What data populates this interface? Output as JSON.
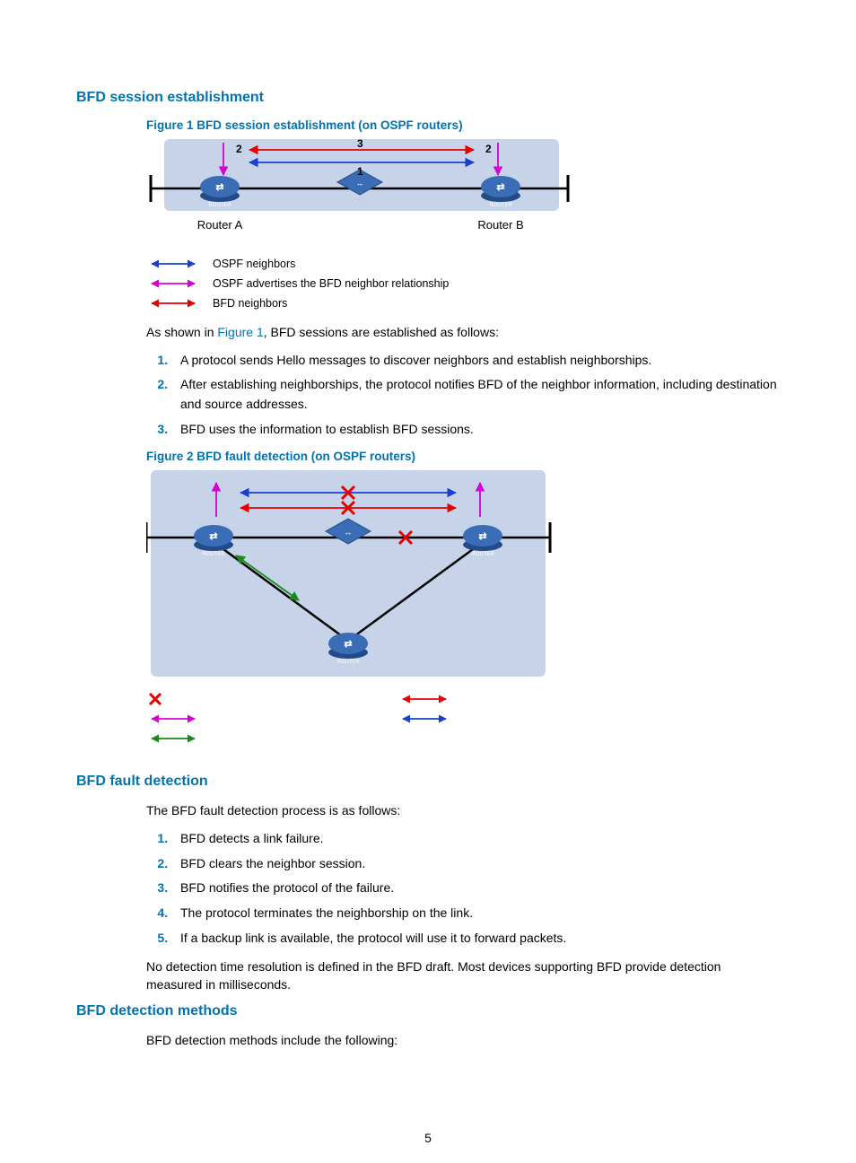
{
  "h_session": "BFD session establishment",
  "fig1_cap": "Figure 1 BFD session establishment (on OSPF routers)",
  "fig1": {
    "n1": "1",
    "n2l": "2",
    "n2r": "2",
    "n3": "3",
    "ra": "Router A",
    "rb": "Router B"
  },
  "legend1": {
    "a": "OSPF neighbors",
    "b": "OSPF advertises the BFD neighbor relationship",
    "c": "BFD neighbors"
  },
  "intro1a": "As shown in ",
  "intro1link": "Figure 1",
  "intro1b": ", BFD sessions are established as follows:",
  "list1": {
    "i1": "A protocol sends Hello messages to discover neighbors and establish neighborships.",
    "i2": "After establishing neighborships, the protocol notifies BFD of the neighbor information, including destination and source addresses.",
    "i3": "BFD uses the information to establish BFD sessions."
  },
  "fig2_cap": "Figure 2 BFD fault detection (on OSPF routers)",
  "h_fault": "BFD fault detection",
  "intro2": "The BFD fault detection process is as follows:",
  "list2": {
    "i1": "BFD detects a link failure.",
    "i2": "BFD clears the neighbor session.",
    "i3": "BFD notifies the protocol of the failure.",
    "i4": "The protocol terminates the neighborship on the link.",
    "i5": "If a backup link is available, the protocol will use it to forward packets."
  },
  "closing": "No detection time resolution is defined in the BFD draft. Most devices supporting BFD provide detection measured in milliseconds.",
  "h_methods": "BFD detection methods",
  "methods_intro": "BFD detection methods include the following:",
  "page_no": "5"
}
